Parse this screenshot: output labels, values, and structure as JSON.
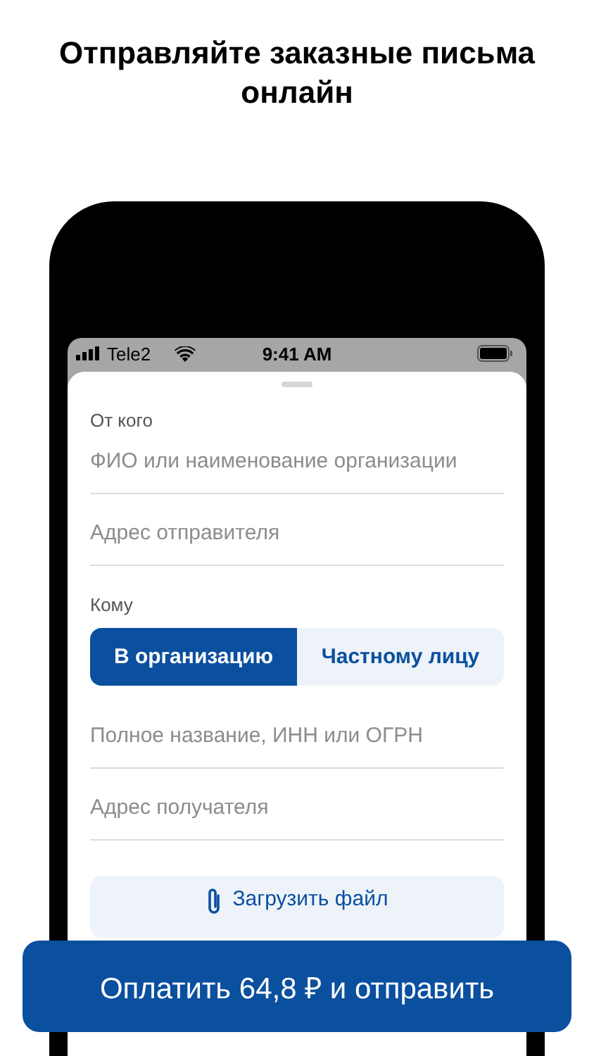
{
  "headline": "Отправляйте заказные письма онлайн",
  "status_bar": {
    "carrier": "Tele2",
    "time": "9:41 AM"
  },
  "form": {
    "items": [
      {
        "kind": "label",
        "text": "От кого"
      },
      {
        "kind": "field",
        "placeholder": "ФИО или наименование организации"
      },
      {
        "kind": "field",
        "placeholder": "Адрес отправителя"
      },
      {
        "kind": "label",
        "text": "Кому"
      },
      {
        "kind": "segmented",
        "options": [
          {
            "label": "В организацию",
            "selected": true
          },
          {
            "label": "Частному лицу",
            "selected": false
          }
        ]
      },
      {
        "kind": "field",
        "placeholder": "Полное название, ИНН или ОГРН"
      },
      {
        "kind": "field",
        "placeholder": "Адрес получателя"
      },
      {
        "kind": "upload",
        "label": "Загрузить файл"
      }
    ]
  },
  "pay_button": {
    "label": "Оплатить 64,8 ₽ и отправить"
  }
}
